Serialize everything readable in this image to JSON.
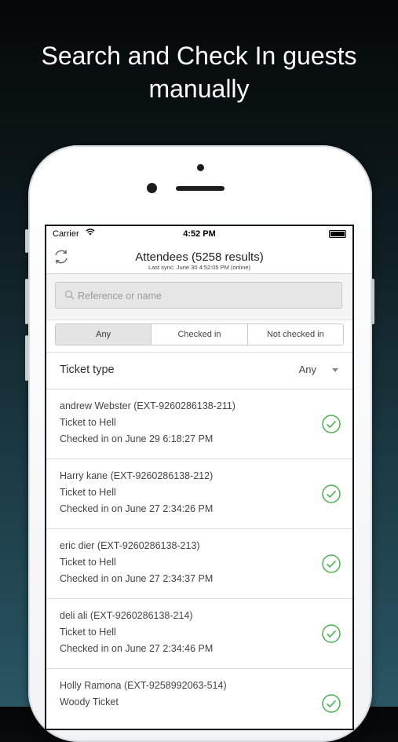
{
  "headline": {
    "line1": "Search and Check In guests",
    "line2": "manually"
  },
  "status_bar": {
    "carrier": "Carrier",
    "time": "4:52 PM"
  },
  "nav": {
    "title": "Attendees (5258 results)",
    "subtitle": "Last sync: June 30 4:52:05 PM (online)"
  },
  "search": {
    "placeholder": "Reference or name"
  },
  "segments": [
    "Any",
    "Checked in",
    "Not checked in"
  ],
  "filter": {
    "label": "Ticket type",
    "value": "Any"
  },
  "attendees": [
    {
      "name": "andrew Webster (EXT-9260286138-211)",
      "ticket": "Ticket to Hell",
      "status": "Checked in on June 29 6:18:27 PM"
    },
    {
      "name": "Harry kane (EXT-9260286138-212)",
      "ticket": "Ticket to Hell",
      "status": "Checked in on June 27 2:34:26 PM"
    },
    {
      "name": "eric dier (EXT-9260286138-213)",
      "ticket": "Ticket to Hell",
      "status": "Checked in on June 27 2:34:37 PM"
    },
    {
      "name": "deli ali (EXT-9260286138-214)",
      "ticket": "Ticket to Hell",
      "status": "Checked in on June 27 2:34:46 PM"
    },
    {
      "name": "Holly Ramona (EXT-9258992063-514)",
      "ticket": "Woody Ticket",
      "status": ""
    }
  ],
  "colors": {
    "check": "#4caf50"
  },
  "icons": {
    "refresh": "refresh-icon",
    "search": "search-icon",
    "check": "check-circle-icon",
    "dropdown": "caret-down-icon"
  }
}
